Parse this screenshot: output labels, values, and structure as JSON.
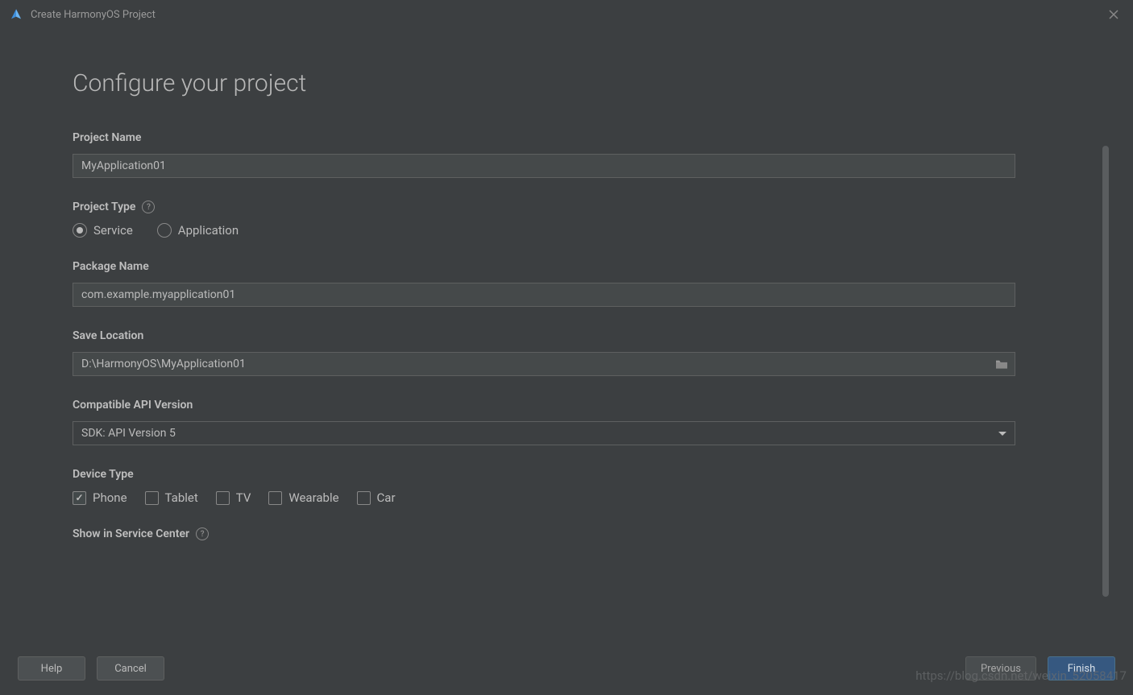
{
  "window": {
    "title": "Create HarmonyOS Project"
  },
  "heading": "Configure your project",
  "form": {
    "projectName": {
      "label": "Project Name",
      "value": "MyApplication01"
    },
    "projectType": {
      "label": "Project Type",
      "options": {
        "service": "Service",
        "application": "Application"
      },
      "selected": "service"
    },
    "packageName": {
      "label": "Package Name",
      "value": "com.example.myapplication01"
    },
    "saveLocation": {
      "label": "Save Location",
      "value": "D:\\HarmonyOS\\MyApplication01"
    },
    "apiVersion": {
      "label": "Compatible API Version",
      "value": "SDK: API Version 5"
    },
    "deviceType": {
      "label": "Device Type",
      "options": {
        "phone": {
          "label": "Phone",
          "checked": true
        },
        "tablet": {
          "label": "Tablet",
          "checked": false
        },
        "tv": {
          "label": "TV",
          "checked": false
        },
        "wearable": {
          "label": "Wearable",
          "checked": false
        },
        "car": {
          "label": "Car",
          "checked": false
        }
      }
    },
    "serviceCenter": {
      "label": "Show in Service Center"
    }
  },
  "buttons": {
    "help": "Help",
    "cancel": "Cancel",
    "previous": "Previous",
    "finish": "Finish"
  },
  "watermark": "https://blog.csdn.net/weixin_52058417"
}
